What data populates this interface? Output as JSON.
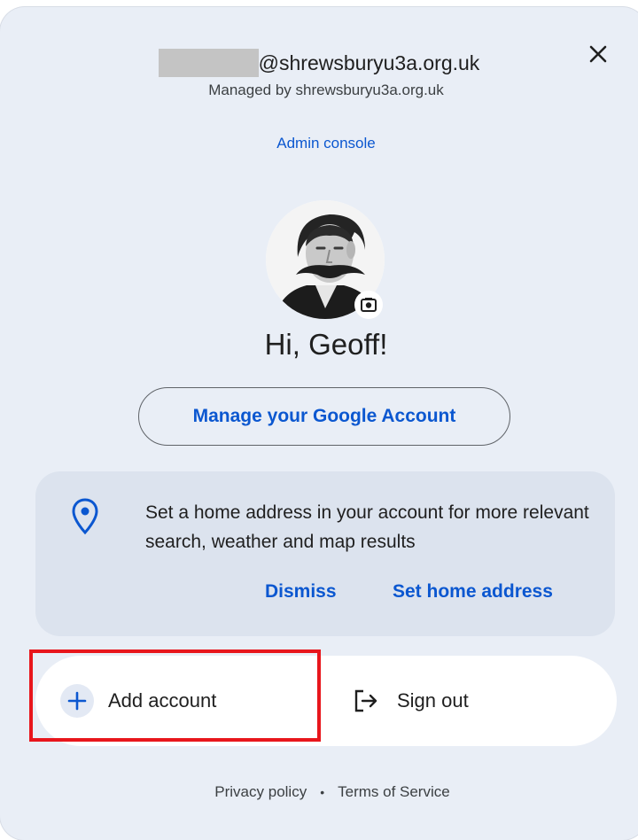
{
  "account": {
    "email_suffix": "@shrewsburyu3a.org.uk",
    "managed_by": "Managed by shrewsburyu3a.org.uk"
  },
  "admin_console_label": "Admin console",
  "profile": {
    "greeting": "Hi, Geoff!"
  },
  "manage_account_label": "Manage your Google Account",
  "home_address_card": {
    "message": "Set a home address in your account for more relevant search, weather and map results",
    "dismiss_label": "Dismiss",
    "set_home_label": "Set home address"
  },
  "actions": {
    "add_account_label": "Add account",
    "sign_out_label": "Sign out"
  },
  "footer": {
    "privacy_label": "Privacy policy",
    "separator": "•",
    "terms_label": "Terms of Service"
  },
  "colors": {
    "panel_bg": "#e9eef6",
    "accent_blue": "#0b57d0",
    "highlight_red": "#e8161c"
  },
  "icons": [
    "close-icon",
    "camera-icon",
    "location-pin-icon",
    "plus-icon",
    "sign-out-icon"
  ]
}
